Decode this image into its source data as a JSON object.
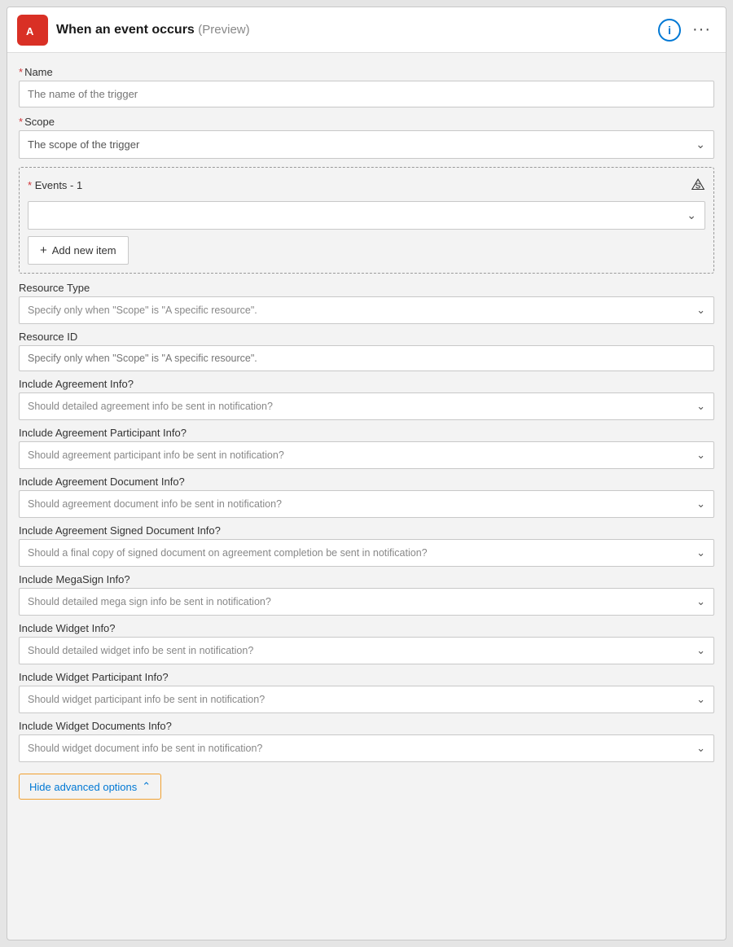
{
  "header": {
    "title": "When an event occurs",
    "preview_label": "(Preview)",
    "info_label": "i",
    "dots_label": "···"
  },
  "name_field": {
    "label": "Name",
    "required": true,
    "placeholder": "The name of the trigger"
  },
  "scope_field": {
    "label": "Scope",
    "required": true,
    "placeholder": "The scope of the trigger"
  },
  "events_section": {
    "label": "Events - 1",
    "required": true,
    "add_new_item_label": "Add new item"
  },
  "resource_type_field": {
    "label": "Resource Type",
    "placeholder": "Specify only when \"Scope\" is \"A specific resource\"."
  },
  "resource_id_field": {
    "label": "Resource ID",
    "placeholder": "Specify only when \"Scope\" is \"A specific resource\"."
  },
  "advanced_fields": [
    {
      "label": "Include Agreement Info?",
      "placeholder": "Should detailed agreement info be sent in notification?"
    },
    {
      "label": "Include Agreement Participant Info?",
      "placeholder": "Should agreement participant info be sent in notification?"
    },
    {
      "label": "Include Agreement Document Info?",
      "placeholder": "Should agreement document info be sent in notification?"
    },
    {
      "label": "Include Agreement Signed Document Info?",
      "placeholder": "Should a final copy of signed document on agreement completion be sent in notification?"
    },
    {
      "label": "Include MegaSign Info?",
      "placeholder": "Should detailed mega sign info be sent in notification?"
    },
    {
      "label": "Include Widget Info?",
      "placeholder": "Should detailed widget info be sent in notification?"
    },
    {
      "label": "Include Widget Participant Info?",
      "placeholder": "Should widget participant info be sent in notification?"
    },
    {
      "label": "Include Widget Documents Info?",
      "placeholder": "Should widget document info be sent in notification?"
    }
  ],
  "hide_advanced_btn_label": "Hide advanced options"
}
